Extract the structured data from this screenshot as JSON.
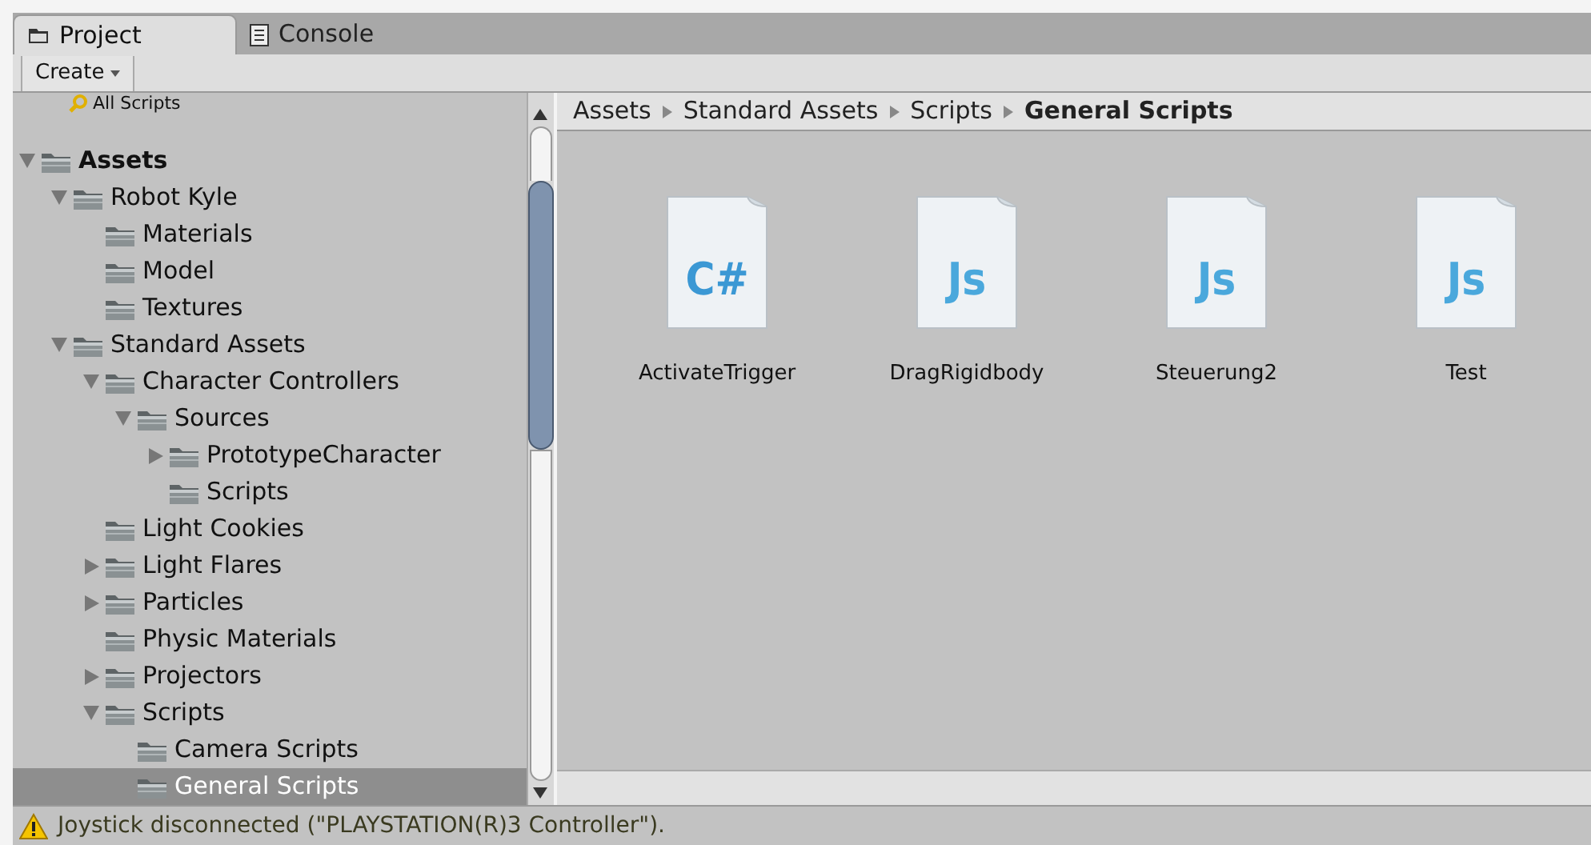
{
  "tabs": [
    {
      "label": "Project",
      "selected": true
    },
    {
      "label": "Console",
      "selected": false
    }
  ],
  "toolbar": {
    "create_button": "Create"
  },
  "tree": {
    "search_item": "All Scripts",
    "items": [
      {
        "label": "Assets",
        "kind": "branch",
        "expanded": true,
        "selected": false,
        "children": [
          {
            "label": "Robot Kyle",
            "kind": "branch",
            "expanded": true,
            "selected": false,
            "children": [
              {
                "label": "Materials",
                "kind": "leaf",
                "selected": false
              },
              {
                "label": "Model",
                "kind": "leaf",
                "selected": false
              },
              {
                "label": "Textures",
                "kind": "leaf",
                "selected": false
              }
            ]
          },
          {
            "label": "Standard Assets",
            "kind": "branch",
            "expanded": true,
            "selected": false,
            "children": [
              {
                "label": "Character Controllers",
                "kind": "branch",
                "expanded": true,
                "selected": false,
                "children": [
                  {
                    "label": "Sources",
                    "kind": "branch",
                    "expanded": true,
                    "selected": false,
                    "children": [
                      {
                        "label": "PrototypeCharacter",
                        "kind": "branch",
                        "expanded": false,
                        "selected": false
                      },
                      {
                        "label": "Scripts",
                        "kind": "leaf",
                        "selected": false
                      }
                    ]
                  }
                ]
              },
              {
                "label": "Light Cookies",
                "kind": "leaf",
                "selected": false
              },
              {
                "label": "Light Flares",
                "kind": "branch",
                "expanded": false,
                "selected": false
              },
              {
                "label": "Particles",
                "kind": "branch",
                "expanded": false,
                "selected": false
              },
              {
                "label": "Physic Materials",
                "kind": "leaf",
                "selected": false
              },
              {
                "label": "Projectors",
                "kind": "branch",
                "expanded": false,
                "selected": false
              },
              {
                "label": "Scripts",
                "kind": "branch",
                "expanded": true,
                "selected": false,
                "children": [
                  {
                    "label": "Camera Scripts",
                    "kind": "leaf",
                    "selected": false
                  },
                  {
                    "label": "General Scripts",
                    "kind": "leaf",
                    "selected": true
                  }
                ]
              }
            ]
          }
        ]
      }
    ]
  },
  "breadcrumb": [
    "Assets",
    "Standard Assets",
    "Scripts",
    "General Scripts"
  ],
  "files": [
    {
      "name": "ActivateTrigger",
      "kind": "cs",
      "glyph": "C#"
    },
    {
      "name": "DragRigidbody",
      "kind": "js",
      "glyph": "Js"
    },
    {
      "name": "Steuerung2",
      "kind": "js",
      "glyph": "Js"
    },
    {
      "name": "Test",
      "kind": "js",
      "glyph": "Js"
    }
  ],
  "status_bar": {
    "message": "Joystick disconnected (\"PLAYSTATION(R)3 Controller\")."
  }
}
